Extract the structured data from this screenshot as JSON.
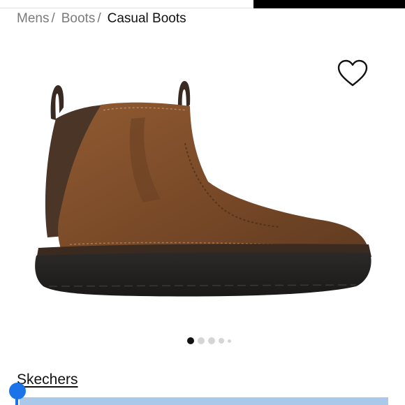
{
  "breadcrumb": {
    "items": [
      {
        "label": "Mens"
      },
      {
        "label": "Boots"
      }
    ],
    "separator": "/",
    "current": "Casual Boots"
  },
  "icons": {
    "favorite": "heart-outline-icon"
  },
  "product": {
    "image": "brown-leather-chelsea-boot",
    "brand": "Skechers"
  },
  "carousel": {
    "total": 5,
    "active": 1
  },
  "colors": {
    "accent": "#1a73e8",
    "active_dot": "#111111",
    "inactive_dot": "#d5d5d5",
    "strip": "#a9c8ea"
  }
}
